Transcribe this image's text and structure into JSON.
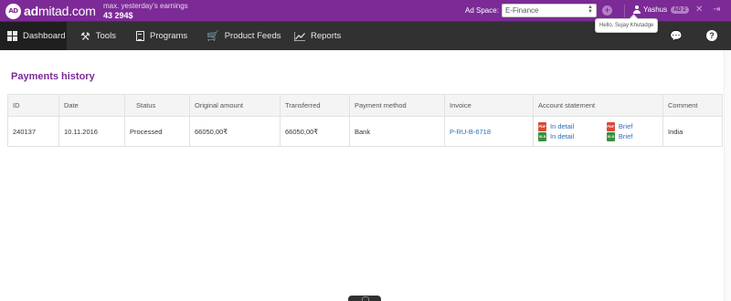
{
  "header": {
    "logo_badge": "AD",
    "logo_text_bold": "ad",
    "logo_text_rest": "mitad.com",
    "earnings_label": "max. yesterday's earnings",
    "earnings_value": "43 294$",
    "ad_space_label": "Ad Space:",
    "ad_space_value": "E-Finance",
    "user_name": "Yashus",
    "user_badge": "AD 2",
    "tooltip": "Hello, Sujay Khutadge",
    "brand_color": "#7c2a96"
  },
  "nav": {
    "items": [
      {
        "label": "Dashboard",
        "icon": "dashboard-icon"
      },
      {
        "label": "Tools",
        "icon": "tools-icon"
      },
      {
        "label": "Programs",
        "icon": "document-icon"
      },
      {
        "label": "Product Feeds",
        "icon": "cart-icon"
      },
      {
        "label": "Reports",
        "icon": "chart-icon"
      }
    ],
    "active": "Dashboard",
    "help_label": "?"
  },
  "page": {
    "title": "Payments history"
  },
  "table": {
    "columns": [
      "ID",
      "Date",
      "Status",
      "Original amount",
      "Transferred",
      "Payment method",
      "Invoice",
      "Account statement",
      "Comment"
    ],
    "rows": [
      {
        "id": "240137",
        "date": "10.11.2016",
        "status": "Processed",
        "original_amount": "66050,00₹",
        "transferred": "66050,00₹",
        "payment_method": "Bank",
        "invoice": "P-RU-B-6718",
        "statement": {
          "pdf_detail": "In detail",
          "pdf_brief": "Brief",
          "xls_detail": "In detail",
          "xls_brief": "Brief",
          "pdf_label": "PDF",
          "xls_label": "XLS"
        },
        "comment": "India"
      }
    ]
  }
}
